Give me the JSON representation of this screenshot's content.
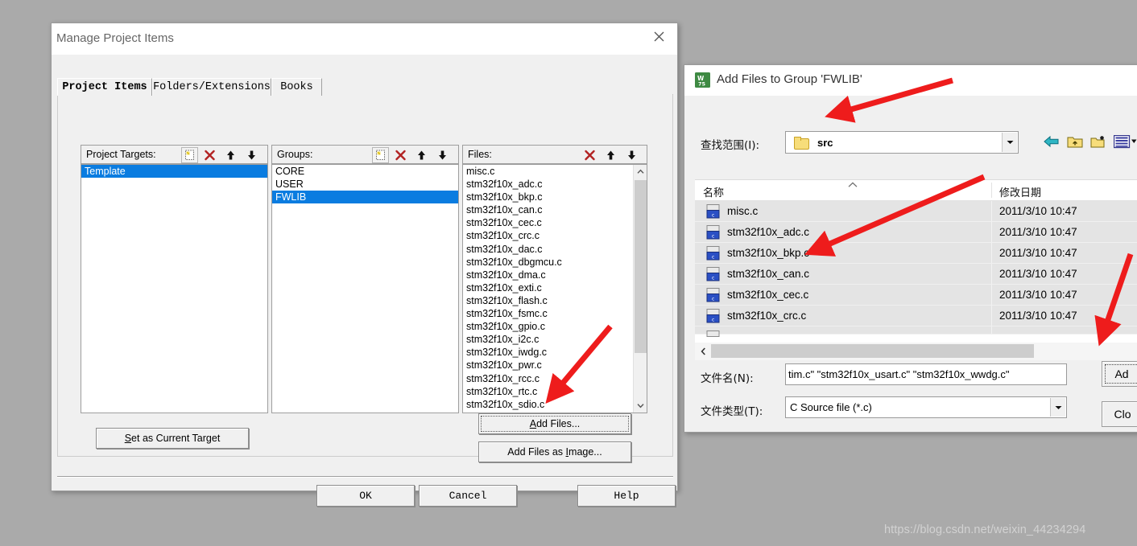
{
  "watermark": "https://blog.csdn.net/weixin_44234294",
  "manage_dialog": {
    "title": "Manage Project Items",
    "close_icon": "close-icon",
    "tabs": [
      {
        "label": "Project Items",
        "selected": true
      },
      {
        "label": "Folders/Extensions",
        "selected": false
      },
      {
        "label": "Books",
        "selected": false
      }
    ],
    "project_targets": {
      "label": "Project Targets:",
      "toolbar": [
        "new-item-icon",
        "delete-icon",
        "move-up-icon",
        "move-down-icon"
      ],
      "items": [
        {
          "label": "Template",
          "selected": true
        }
      ]
    },
    "groups": {
      "label": "Groups:",
      "toolbar": [
        "new-item-icon",
        "delete-icon",
        "move-up-icon",
        "move-down-icon"
      ],
      "items": [
        {
          "label": "CORE",
          "selected": false
        },
        {
          "label": "USER",
          "selected": false
        },
        {
          "label": "FWLIB",
          "selected": true
        }
      ]
    },
    "files": {
      "label": "Files:",
      "toolbar": [
        "delete-icon",
        "move-up-icon",
        "move-down-icon"
      ],
      "items": [
        "misc.c",
        "stm32f10x_adc.c",
        "stm32f10x_bkp.c",
        "stm32f10x_can.c",
        "stm32f10x_cec.c",
        "stm32f10x_crc.c",
        "stm32f10x_dac.c",
        "stm32f10x_dbgmcu.c",
        "stm32f10x_dma.c",
        "stm32f10x_exti.c",
        "stm32f10x_flash.c",
        "stm32f10x_fsmc.c",
        "stm32f10x_gpio.c",
        "stm32f10x_i2c.c",
        "stm32f10x_iwdg.c",
        "stm32f10x_pwr.c",
        "stm32f10x_rcc.c",
        "stm32f10x_rtc.c",
        "stm32f10x_sdio.c"
      ],
      "scrollbar": {
        "up_icon": "chevron-up-icon",
        "down_icon": "chevron-down-icon"
      }
    },
    "buttons": {
      "set_as_current_target": "Set as Current Target",
      "set_as_current_target_accel": "S",
      "add_files": "Add Files...",
      "add_files_accel": "A",
      "add_files_as_image": "Add Files as Image...",
      "add_files_as_image_accel": "I",
      "ok": "OK",
      "cancel": "Cancel",
      "help": "Help"
    }
  },
  "add_files_dialog": {
    "title": "Add Files to Group 'FWLIB'",
    "app_icon": "uvision-icon",
    "look_in_label": "查找范围(I):",
    "look_in_value": "src",
    "look_in_dropdown_icon": "chevron-down-icon",
    "toolbar": [
      "back-arrow-icon",
      "up-folder-icon",
      "new-folder-icon",
      "view-list-icon",
      "view-dropdown-icon"
    ],
    "columns": [
      "名称",
      "修改日期"
    ],
    "sort_indicator_icon": "sort-ascending-icon",
    "rows": [
      {
        "name": "misc.c",
        "date": "2011/3/10 10:47",
        "icon": "c-source-file-icon"
      },
      {
        "name": "stm32f10x_adc.c",
        "date": "2011/3/10 10:47",
        "icon": "c-source-file-icon"
      },
      {
        "name": "stm32f10x_bkp.c",
        "date": "2011/3/10 10:47",
        "icon": "c-source-file-icon"
      },
      {
        "name": "stm32f10x_can.c",
        "date": "2011/3/10 10:47",
        "icon": "c-source-file-icon"
      },
      {
        "name": "stm32f10x_cec.c",
        "date": "2011/3/10 10:47",
        "icon": "c-source-file-icon"
      },
      {
        "name": "stm32f10x_crc.c",
        "date": "2011/3/10 10:47",
        "icon": "c-source-file-icon"
      }
    ],
    "h_scrollbar": {
      "left_icon": "chevron-left-icon"
    },
    "file_name_label": "文件名(N):",
    "file_name_value": "tim.c\" \"stm32f10x_usart.c\" \"stm32f10x_wwdg.c\"",
    "file_type_label": "文件类型(T):",
    "file_type_value": "C Source file (*.c)",
    "file_type_dropdown_icon": "chevron-down-icon",
    "add_button": "Ad",
    "close_button": "Clo"
  }
}
